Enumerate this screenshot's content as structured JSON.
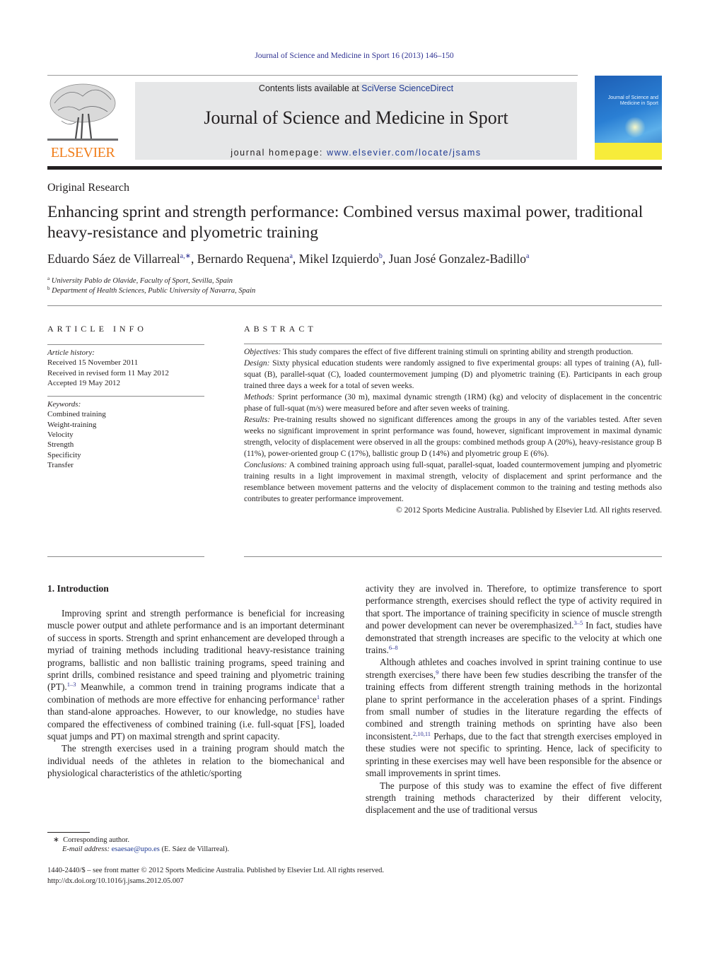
{
  "running_head": "Journal of Science and Medicine in Sport 16 (2013) 146–150",
  "masthead": {
    "publisher_logo_text": "ELSEVIER",
    "contents_prefix": "Contents lists available at ",
    "contents_link": "SciVerse ScienceDirect",
    "journal_title": "Journal of Science and Medicine in Sport",
    "homepage_prefix": "journal homepage: ",
    "homepage_link": "www.elsevier.com/locate/jsams",
    "cover_title": "Journal of Science and Medicine in Sport"
  },
  "colors": {
    "link_blue": "#2e3192",
    "elsevier_orange": "#f07d1a",
    "masthead_gray": "#e6e7e8",
    "cover_blue": "#2a7fd4",
    "cover_yellow": "#f7ec3a"
  },
  "article": {
    "section_type": "Original Research",
    "title": "Enhancing sprint and strength performance: Combined versus maximal power, traditional heavy-resistance and plyometric training",
    "authors": [
      {
        "name": "Eduardo Sáez de Villarreal",
        "aff": "a,∗"
      },
      {
        "name": "Bernardo Requena",
        "aff": "a"
      },
      {
        "name": "Mikel Izquierdo",
        "aff": "b"
      },
      {
        "name": "Juan José Gonzalez-Badillo",
        "aff": "a"
      }
    ],
    "affiliations": [
      {
        "key": "a",
        "text": "University Pablo de Olavide, Faculty of Sport, Sevilla, Spain"
      },
      {
        "key": "b",
        "text": "Department of Health Sciences, Public University of Navarra, Spain"
      }
    ]
  },
  "article_info": {
    "heading": "ARTICLE INFO",
    "history_label": "Article history:",
    "history": [
      "Received 15 November 2011",
      "Received in revised form 11 May 2012",
      "Accepted 19 May 2012"
    ],
    "keywords_label": "Keywords:",
    "keywords": [
      "Combined training",
      "Weight-training",
      "Velocity",
      "Strength",
      "Specificity",
      "Transfer"
    ]
  },
  "abstract": {
    "heading": "ABSTRACT",
    "sections": [
      {
        "label": "Objectives:",
        "text": " This study compares the effect of five different training stimuli on sprinting ability and strength production."
      },
      {
        "label": "Design:",
        "text": " Sixty physical education students were randomly assigned to five experimental groups: all types of training (A), full-squat (B), parallel-squat (C), loaded countermovement jumping (D) and plyometric training (E). Participants in each group trained three days a week for a total of seven weeks."
      },
      {
        "label": "Methods:",
        "text": " Sprint performance (30 m), maximal dynamic strength (1RM) (kg) and velocity of displacement in the concentric phase of full-squat (m/s) were measured before and after seven weeks of training."
      },
      {
        "label": "Results:",
        "text": " Pre-training results showed no significant differences among the groups in any of the variables tested. After seven weeks no significant improvement in sprint performance was found, however, significant improvement in maximal dynamic strength, velocity of displacement were observed in all the groups: combined methods group A (20%), heavy-resistance group B (11%), power-oriented group C (17%), ballistic group D (14%) and plyometric group E (6%)."
      },
      {
        "label": "Conclusions:",
        "text": " A combined training approach using full-squat, parallel-squat, loaded countermovement jumping and plyometric training results in a light improvement in maximal strength, velocity of displacement and sprint performance and the resemblance between movement patterns and the velocity of displacement common to the training and testing methods also contributes to greater performance improvement."
      }
    ],
    "copyright": "© 2012 Sports Medicine Australia. Published by Elsevier Ltd. All rights reserved."
  },
  "body": {
    "section_heading": "1.  Introduction",
    "left_paragraphs": [
      {
        "segments": [
          {
            "t": "Improving sprint and strength performance is beneficial for increasing muscle power output and athlete performance and is an important determinant of success in sports. Strength and sprint enhancement are developed through a myriad of training methods including traditional heavy-resistance training programs, ballistic and non ballistic training programs, speed training and sprint drills, combined resistance and speed training and plyometric training (PT)."
          },
          {
            "ref": "1–3"
          },
          {
            "t": " Meanwhile, a common trend in training programs indicate that a combination of methods are more effective for enhancing performance"
          },
          {
            "ref": "1"
          },
          {
            "t": " rather than stand-alone approaches. However, to our knowledge, no studies have compared the effectiveness of combined training (i.e. full-squat [FS], loaded squat jumps and PT) on maximal strength and sprint capacity."
          }
        ]
      },
      {
        "segments": [
          {
            "t": "The strength exercises used in a training program should match the individual needs of the athletes in relation to the biomechanical and physiological characteristics of the athletic/sporting"
          }
        ]
      }
    ],
    "right_paragraphs": [
      {
        "continuation": true,
        "segments": [
          {
            "t": "activity they are involved in. Therefore, to optimize transference to sport performance strength, exercises should reflect the type of activity required in that sport. The importance of training specificity in science of muscle strength and power development can never be overemphasized."
          },
          {
            "ref": "3–5"
          },
          {
            "t": " In fact, studies have demonstrated that strength increases are specific to the velocity at which one trains."
          },
          {
            "ref": "6–8"
          }
        ]
      },
      {
        "segments": [
          {
            "t": "Although athletes and coaches involved in sprint training continue to use strength exercises,"
          },
          {
            "ref": "9"
          },
          {
            "t": " there have been few studies describing the transfer of the training effects from different strength training methods in the horizontal plane to sprint performance in the acceleration phases of a sprint. Findings from small number of studies in the literature regarding the effects of combined and strength training methods on sprinting have also been inconsistent."
          },
          {
            "ref": "2,10,11"
          },
          {
            "t": " Perhaps, due to the fact that strength exercises employed in these studies were not specific to sprinting. Hence, lack of specificity to sprinting in these exercises may well have been responsible for the absence or small improvements in sprint times."
          }
        ]
      },
      {
        "segments": [
          {
            "t": "The purpose of this study was to examine the effect of five different strength training methods characterized by their different velocity, displacement and the use of traditional versus"
          }
        ]
      }
    ]
  },
  "footnote": {
    "mark": "∗",
    "corresponding": "Corresponding author.",
    "email_label": "E-mail address:",
    "email": "esaesae@upo.es",
    "email_owner": " (E. Sáez de Villarreal)."
  },
  "bottom": {
    "issn_line": "1440-2440/$ – see front matter © 2012 Sports Medicine Australia. Published by Elsevier Ltd. All rights reserved.",
    "doi": "http://dx.doi.org/10.1016/j.jsams.2012.05.007"
  }
}
